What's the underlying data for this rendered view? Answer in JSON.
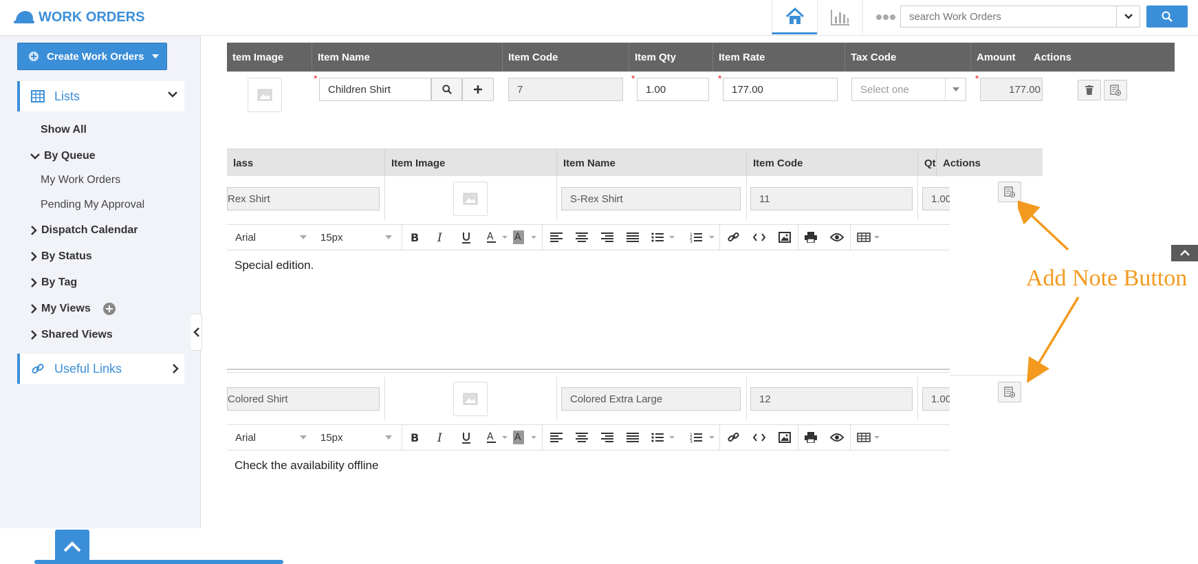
{
  "app": {
    "title": "WORK ORDERS"
  },
  "search": {
    "placeholder": "search Work Orders"
  },
  "sidebar": {
    "create_label": "Create Work Orders",
    "lists_label": "Lists",
    "show_all": "Show All",
    "by_queue": "By Queue",
    "my_work_orders": "My Work Orders",
    "pending_my_approval": "Pending My Approval",
    "dispatch_calendar": "Dispatch Calendar",
    "by_status": "By Status",
    "by_tag": "By Tag",
    "my_views": "My Views",
    "shared_views": "Shared Views",
    "useful_links": "Useful Links"
  },
  "item_table": {
    "headers": [
      "tem Image",
      "Item Name",
      "Item Code",
      "Item Qty",
      "Item Rate",
      "Tax Code",
      "Amount",
      "Actions"
    ],
    "row": {
      "item_name": "Children Shirt",
      "item_code": "7",
      "qty": "1.00",
      "rate": "177.00",
      "tax_placeholder": "Select one",
      "amount": "177.00"
    }
  },
  "sub_table": {
    "headers": [
      "lass",
      "Item Image",
      "Item Name",
      "Item Code",
      "Qt",
      "Actions"
    ],
    "rows": [
      {
        "class": "Rex Shirt",
        "item_name": "S-Rex Shirt",
        "item_code": "11",
        "qty": "1.00",
        "note": "Special edition."
      },
      {
        "class": "Colored Shirt",
        "item_name": "Colored Extra Large",
        "item_code": "12",
        "qty": "1.00",
        "note": "Check the availability offline"
      }
    ]
  },
  "editor": {
    "font": "Arial",
    "size": "15px"
  },
  "annotation": {
    "label": "Add Note Button",
    "color": "#f39a1e"
  },
  "colors": {
    "accent": "#3b8fd9",
    "header_dark": "#646464"
  }
}
